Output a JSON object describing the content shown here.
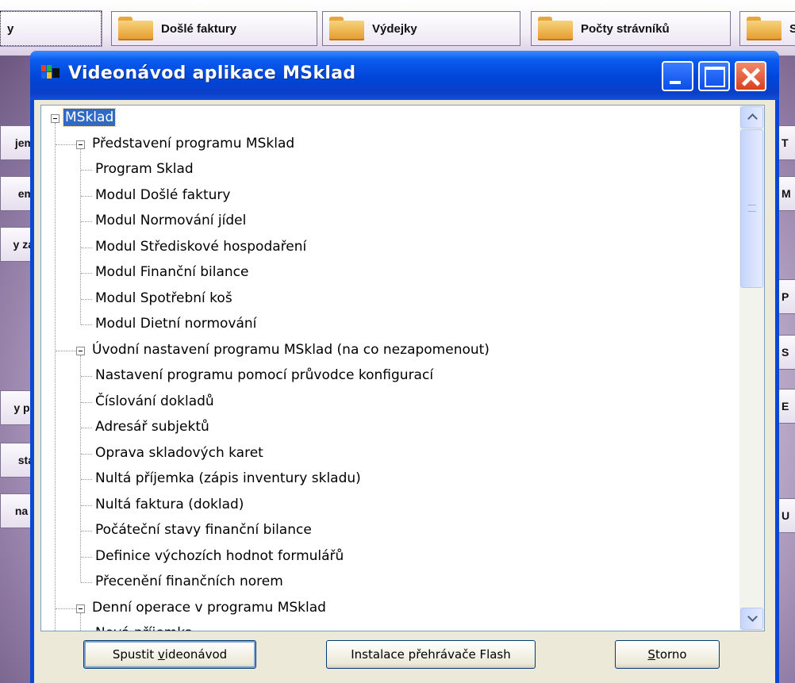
{
  "background_app": {
    "top_buttons": [
      {
        "label": "y"
      },
      {
        "label": "Došlé faktury"
      },
      {
        "label": "Výdejky"
      },
      {
        "label": "Počty strávníků"
      },
      {
        "label": "S"
      }
    ],
    "left_buttons": [
      "jem",
      "em",
      "y za",
      "y př",
      "sta",
      "na l"
    ],
    "right_buttons": [
      "T",
      "M",
      "P",
      "S",
      "E",
      "U"
    ]
  },
  "dialog": {
    "title": "Videonávod aplikace MSklad",
    "tree": {
      "root": "MSklad",
      "nodes": [
        {
          "label": "Představení programu MSklad",
          "level": 1,
          "expanded": true
        },
        {
          "label": "Program Sklad",
          "level": 2
        },
        {
          "label": "Modul Došlé faktury",
          "level": 2
        },
        {
          "label": "Modul Normování jídel",
          "level": 2
        },
        {
          "label": "Modul Střediskové hospodaření",
          "level": 2
        },
        {
          "label": "Modul Finanční bilance",
          "level": 2
        },
        {
          "label": "Modul Spotřební koš",
          "level": 2
        },
        {
          "label": "Modul Dietní normování",
          "level": 2
        },
        {
          "label": "Úvodní nastavení programu MSklad (na co nezapomenout)",
          "level": 1,
          "expanded": true
        },
        {
          "label": "Nastavení programu pomocí průvodce konfigurací",
          "level": 2
        },
        {
          "label": "Číslování dokladů",
          "level": 2
        },
        {
          "label": "Adresář subjektů",
          "level": 2
        },
        {
          "label": "Oprava skladových karet",
          "level": 2
        },
        {
          "label": "Nultá příjemka (zápis inventury skladu)",
          "level": 2
        },
        {
          "label": "Nultá faktura (doklad)",
          "level": 2
        },
        {
          "label": "Počáteční stavy finanční bilance",
          "level": 2
        },
        {
          "label": "Definice výchozích hodnot formulářů",
          "level": 2
        },
        {
          "label": "Přecenění finančních norem",
          "level": 2
        },
        {
          "label": "Denní operace v programu MSklad",
          "level": 1,
          "expanded": true
        },
        {
          "label": "Nová příjemka",
          "level": 2
        }
      ]
    },
    "buttons": {
      "play": "Spustit videonávod",
      "install_flash": "Instalace přehrávače Flash",
      "cancel": "Storno"
    }
  }
}
